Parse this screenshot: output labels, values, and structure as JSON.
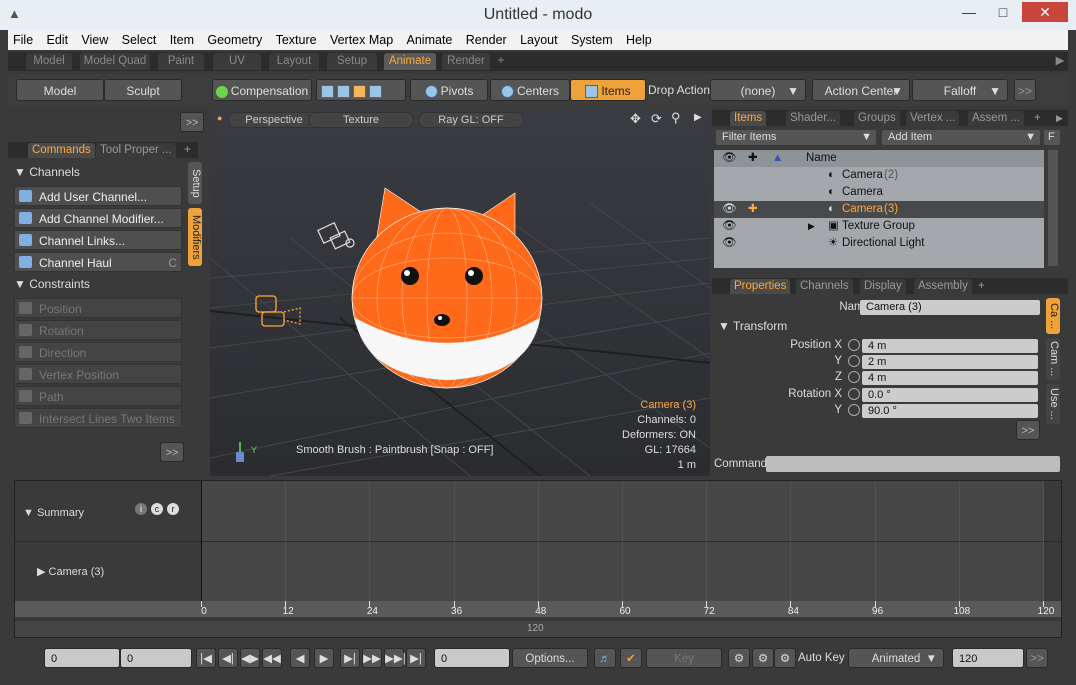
{
  "window": {
    "title": "Untitled - modo"
  },
  "menu": [
    "File",
    "Edit",
    "View",
    "Select",
    "Item",
    "Geometry",
    "Texture",
    "Vertex Map",
    "Animate",
    "Render",
    "Layout",
    "System",
    "Help"
  ],
  "layout_tabs": [
    "Model",
    "Model Quad",
    "Paint",
    "UV",
    "Layout",
    "Setup",
    "Animate",
    "Render",
    "+"
  ],
  "active_layout_tab": "Animate",
  "toolbar": {
    "model": "Model",
    "sculpt": "Sculpt",
    "compensation": "Compensation",
    "pivots": "Pivots",
    "centers": "Centers",
    "items": "Items",
    "drop_action": "Drop Action",
    "drop_value": "(none)",
    "action_center": "Action Center",
    "falloff": "Falloff",
    "more": ">>"
  },
  "left_panel": {
    "expand": ">>",
    "tabs": [
      "Commands",
      "Tool Proper ..."
    ],
    "vertical_tabs": [
      "Setup",
      "Modifiers"
    ],
    "channels_header": "Channels",
    "channel_cmds": [
      "Add User Channel...",
      "Add Channel Modifier...",
      "Channel Links...",
      "Channel Haul"
    ],
    "channel_haul_shortcut": "C",
    "constraints_header": "Constraints",
    "constraint_cmds": [
      "Position",
      "Rotation",
      "Direction",
      "Vertex Position",
      "Path",
      "Intersect Lines Two Items"
    ],
    "more": ">>"
  },
  "viewport": {
    "view_mode": "Perspective",
    "shading": "Texture",
    "raygl": "Ray GL: OFF",
    "tool_line": "Smooth Brush : Paintbrush  [Snap : OFF]",
    "info": {
      "item": "Camera (3)",
      "channels": "Channels: 0",
      "deformers": "Deformers: ON",
      "gl": "GL: 17664",
      "scale": "1 m"
    },
    "axis_label": "Y"
  },
  "items_panel": {
    "tabs": [
      "Items",
      "Shader...",
      "Groups",
      "Vertex ...",
      "Assem ..."
    ],
    "filter": "Filter Items",
    "add_item": "Add Item",
    "f": "F",
    "name_col": "Name",
    "rows": [
      {
        "label": "Camera",
        "count": "(2)"
      },
      {
        "label": "Camera",
        "count": ""
      },
      {
        "label": "Camera",
        "count": "(3)"
      },
      {
        "label": "Texture Group",
        "count": ""
      },
      {
        "label": "Directional Light",
        "count": ""
      }
    ]
  },
  "props_panel": {
    "tabs": [
      "Properties",
      "Channels",
      "Display",
      "Assembly"
    ],
    "name_label": "Name",
    "name_value": "Camera (3)",
    "transform_header": "Transform",
    "position_x_label": "Position X",
    "position_x": "4 m",
    "position_y_label": "Y",
    "position_y": "2 m",
    "position_z_label": "Z",
    "position_z": "4 m",
    "rotation_x_label": "Rotation X",
    "rotation_x": "0.0 °",
    "rotation_y_label": "Y",
    "rotation_y": "90.0 °",
    "vertical_tabs": [
      "Ca ...",
      "Cam ...",
      "Use ..."
    ],
    "more": ">>",
    "command_label": "Command"
  },
  "timeline": {
    "summary": "Summary",
    "camera_row": "Camera (3)",
    "summary_badges": [
      "i",
      "c",
      "r"
    ],
    "ticks": [
      "0",
      "12",
      "24",
      "36",
      "48",
      "60",
      "72",
      "84",
      "96",
      "108",
      "120"
    ],
    "range_end": "120"
  },
  "bottom_bar": {
    "start": "0",
    "current": "0",
    "frame": "0",
    "options": "Options...",
    "key": "Key",
    "auto_key": "Auto Key",
    "animated": "Animated",
    "end": "120",
    "more": ">>"
  },
  "colors": {
    "accent": "#f0a23a",
    "accent_text": "#ffa83a"
  }
}
